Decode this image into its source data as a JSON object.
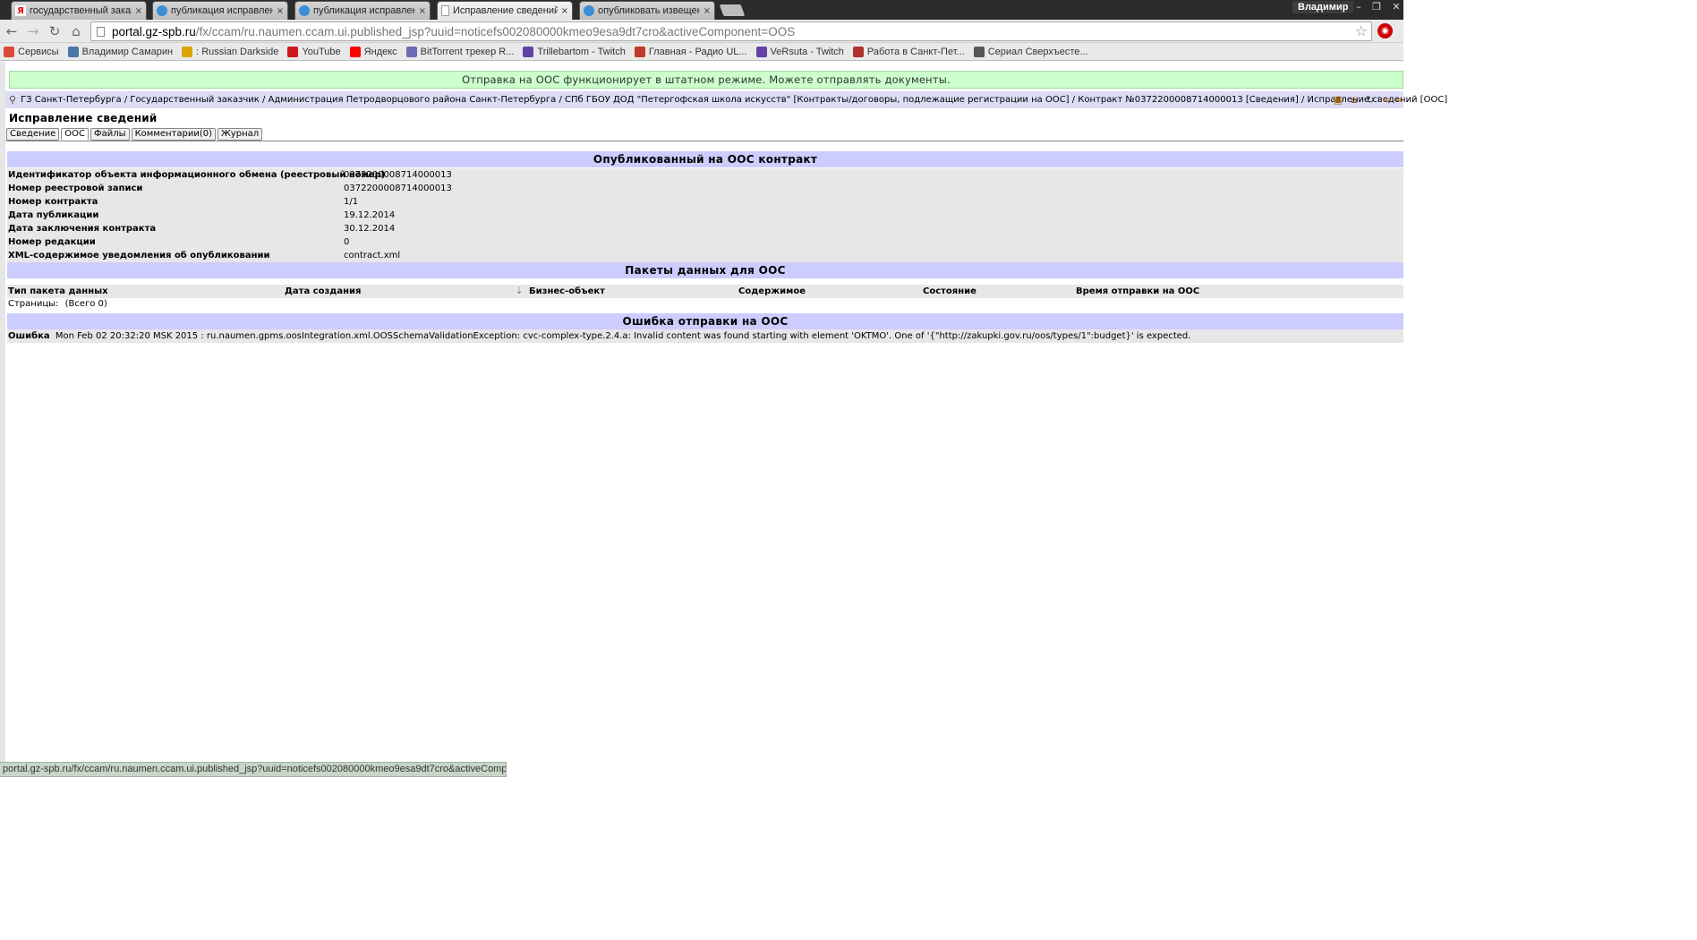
{
  "browser": {
    "tabs": [
      {
        "title": "государственный заказ с",
        "icon": "yandex-icon"
      },
      {
        "title": "публикация исправлени",
        "icon": "globe-icon"
      },
      {
        "title": "публикация исправлени",
        "icon": "globe-icon"
      },
      {
        "title": "Исправление сведений",
        "icon": "page-icon",
        "active": true
      },
      {
        "title": "опубликовать извещени",
        "icon": "globe-icon"
      }
    ],
    "tab_close": "×",
    "user": "Владимир",
    "url_host": "portal.gz-spb.ru",
    "url_path": "/fx/ccam/ru.naumen.ccam.ui.published_jsp?uuid=noticefs002080000kmeo9esa9dt7cro&activeComponent=OOS",
    "bookmarks": [
      {
        "label": "Сервисы",
        "icon": "apps-icon",
        "color": "#d94a38"
      },
      {
        "label": "Владимир Самарин",
        "icon": "vk-icon",
        "color": "#4a76a8"
      },
      {
        "label": ": Russian Darkside",
        "icon": "darkside-icon",
        "color": "#d9a400"
      },
      {
        "label": "YouTube",
        "icon": "youtube-icon",
        "color": "#cc181e"
      },
      {
        "label": "Яндекс",
        "icon": "yandex-icon",
        "color": "#ff0000"
      },
      {
        "label": "BitTorrent трекер R...",
        "icon": "torrent-icon",
        "color": "#6b6bb5"
      },
      {
        "label": "Trillebartom - Twitch",
        "icon": "twitch-icon",
        "color": "#6441a4"
      },
      {
        "label": "Главная - Радио UL...",
        "icon": "radio-icon",
        "color": "#c0392b"
      },
      {
        "label": "VeRsuta - Twitch",
        "icon": "twitch-icon",
        "color": "#6441a4"
      },
      {
        "label": "Работа в Санкт-Пет...",
        "icon": "job-icon",
        "color": "#b03030"
      },
      {
        "label": "Сериал Сверхъесте...",
        "icon": "series-icon",
        "color": "#555555"
      }
    ],
    "status_url": "portal.gz-spb.ru/fx/ccam/ru.naumen.ccam.ui.published_jsp?uuid=noticefs002080000kmeo9esa9dt7cro&activeComponent=OOS"
  },
  "notice": "Отправка на ООС функционирует в штатном режиме. Можете отправлять документы.",
  "breadcrumb": "ГЗ Санкт-Петербурга / Государственный заказчик / Администрация Петродворцового района Санкт-Петербурга / СПб ГБОУ ДОД \"Петергофская школа искусств\" [Контракты/договоры, подлежащие регистрации на ООС] / Контракт №0372200008714000013 [Сведения] / Исправление сведений [ООС]",
  "page_title": "Исправление сведений",
  "page_tabs": [
    {
      "label": "Сведение"
    },
    {
      "label": "ООС",
      "active": true
    },
    {
      "label": "Файлы"
    },
    {
      "label": "Комментарии(0)"
    },
    {
      "label": "Журнал"
    }
  ],
  "published_section": {
    "title": "Опубликованный на ООС контракт",
    "rows": [
      {
        "label": "Идентификатор объекта информационного обмена (реестровый номер)",
        "value": "0372200008714000013"
      },
      {
        "label": "Номер реестровой записи",
        "value": "0372200008714000013"
      },
      {
        "label": "Номер контракта",
        "value": "1/1"
      },
      {
        "label": "Дата публикации",
        "value": "19.12.2014"
      },
      {
        "label": "Дата заключения контракта",
        "value": "30.12.2014"
      },
      {
        "label": "Номер редакции",
        "value": "0"
      },
      {
        "label": "XML-содержимое уведомления об опубликовании",
        "value": "contract.xml"
      }
    ]
  },
  "packets_section": {
    "title": "Пакеты данных для ООС",
    "columns": [
      "Тип пакета данных",
      "Дата создания",
      "Бизнес-объект",
      "Содержимое",
      "Состояние",
      "Время отправки на ООС"
    ],
    "pager_label": "Страницы:",
    "pager_total": "(Всего 0)"
  },
  "error_section": {
    "title": "Ошибка отправки на ООС",
    "label": "Ошибка",
    "text": "Mon Feb 02 20:32:20 MSK 2015 : ru.naumen.gpms.oosIntegration.xml.OOSSchemaValidationException: cvc-complex-type.2.4.a: Invalid content was found starting with element 'OKTMO'. One of '{\"http://zakupki.gov.ru/oos/types/1\":budget}' is expected."
  },
  "colors": {
    "notice_bg": "#ccffcc",
    "section_bg": "#ccccff",
    "row_bg": "#e7e7e7",
    "crumbs_bg": "#dcdcf5"
  }
}
